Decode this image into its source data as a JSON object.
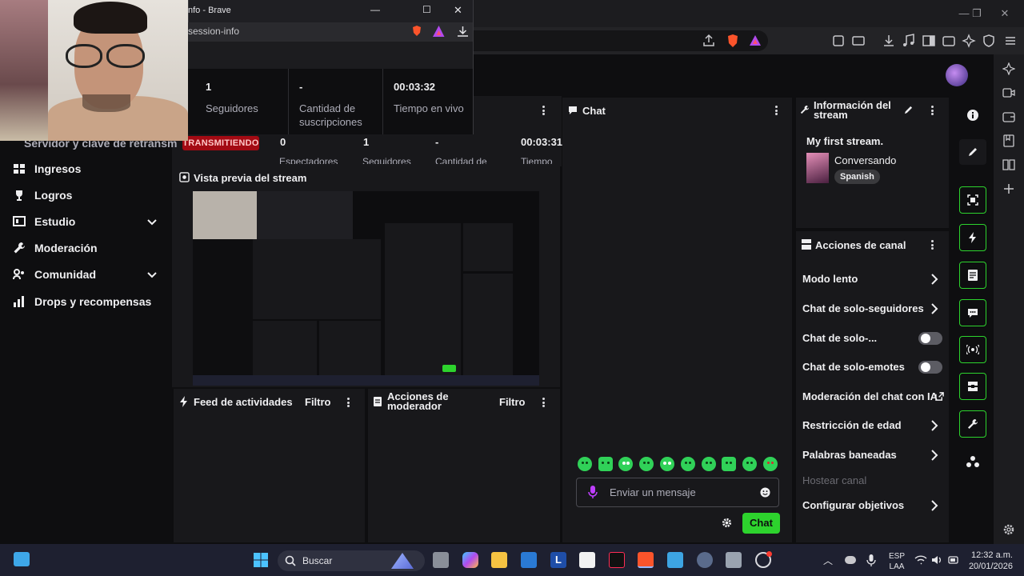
{
  "browser": {
    "window_title": "nfo - Brave",
    "url_fragment": "session-info",
    "brave_badge": "1"
  },
  "stats": [
    {
      "value": "1",
      "label_lines": [
        "Seguidores"
      ]
    },
    {
      "value": "-",
      "label_lines": [
        "Cantidad de",
        "suscripciones"
      ]
    },
    {
      "value": "00:03:32",
      "label_lines": [
        "Tiempo en vivo"
      ]
    }
  ],
  "status_strip": {
    "partial_nav_text": "Servidor y clave de retransm",
    "live_badge": "TRANSMITIENDO",
    "values": [
      "0",
      "1",
      "-",
      "00:03:31"
    ],
    "labels_partial": [
      "Espectadores",
      "Seguidores",
      "Cantidad de",
      "Tiempo"
    ]
  },
  "nav": {
    "items": [
      {
        "label": "Ingresos",
        "icon": "revenue-icon",
        "chevron": false
      },
      {
        "label": "Logros",
        "icon": "trophy-icon",
        "chevron": false
      },
      {
        "label": "Estudio",
        "icon": "studio-icon",
        "chevron": true
      },
      {
        "label": "Moderación",
        "icon": "wrench-icon",
        "chevron": false
      },
      {
        "label": "Comunidad",
        "icon": "community-icon",
        "chevron": true
      },
      {
        "label": "Drops y recompensas",
        "icon": "drops-icon",
        "chevron": false
      }
    ]
  },
  "preview": {
    "title": "Vista previa del stream"
  },
  "activity_feed": {
    "title": "Feed de actividades",
    "filter": "Filtro"
  },
  "mod_actions": {
    "title_lines": [
      "Acciones de",
      "moderador"
    ],
    "filter": "Filtro"
  },
  "chat": {
    "title": "Chat",
    "placeholder": "Enviar un mensaje",
    "send_label": "Chat"
  },
  "stream_info": {
    "title_lines": [
      "Información del",
      "stream"
    ],
    "stream_title": "My first stream.",
    "category": "Conversando",
    "tag": "Spanish"
  },
  "channel_actions": {
    "title": "Acciones de canal",
    "rows": [
      {
        "label": "Modo lento",
        "type": "arrow"
      },
      {
        "label": "Chat de solo-seguidores",
        "type": "arrow"
      },
      {
        "label": "Chat de solo-...",
        "type": "toggle"
      },
      {
        "label": "Chat de solo-emotes",
        "type": "toggle"
      },
      {
        "label": "Moderación del chat con IA",
        "type": "external"
      },
      {
        "label": "Restricción de edad",
        "type": "arrow"
      },
      {
        "label": "Palabras baneadas",
        "type": "arrow"
      },
      {
        "label": "Hostear canal",
        "type": "disabled"
      },
      {
        "label": "Configurar objetivos",
        "type": "arrow"
      }
    ]
  },
  "taskbar": {
    "search_placeholder": "Buscar",
    "lang_top": "ESP",
    "lang_bottom": "LAA",
    "time": "12:32 a.m.",
    "date": "20/01/2026"
  },
  "colors": {
    "accent_green": "#2dd32d",
    "live_red": "#a30a13",
    "panel_bg": "#18181b",
    "page_bg": "#0e0e10"
  }
}
